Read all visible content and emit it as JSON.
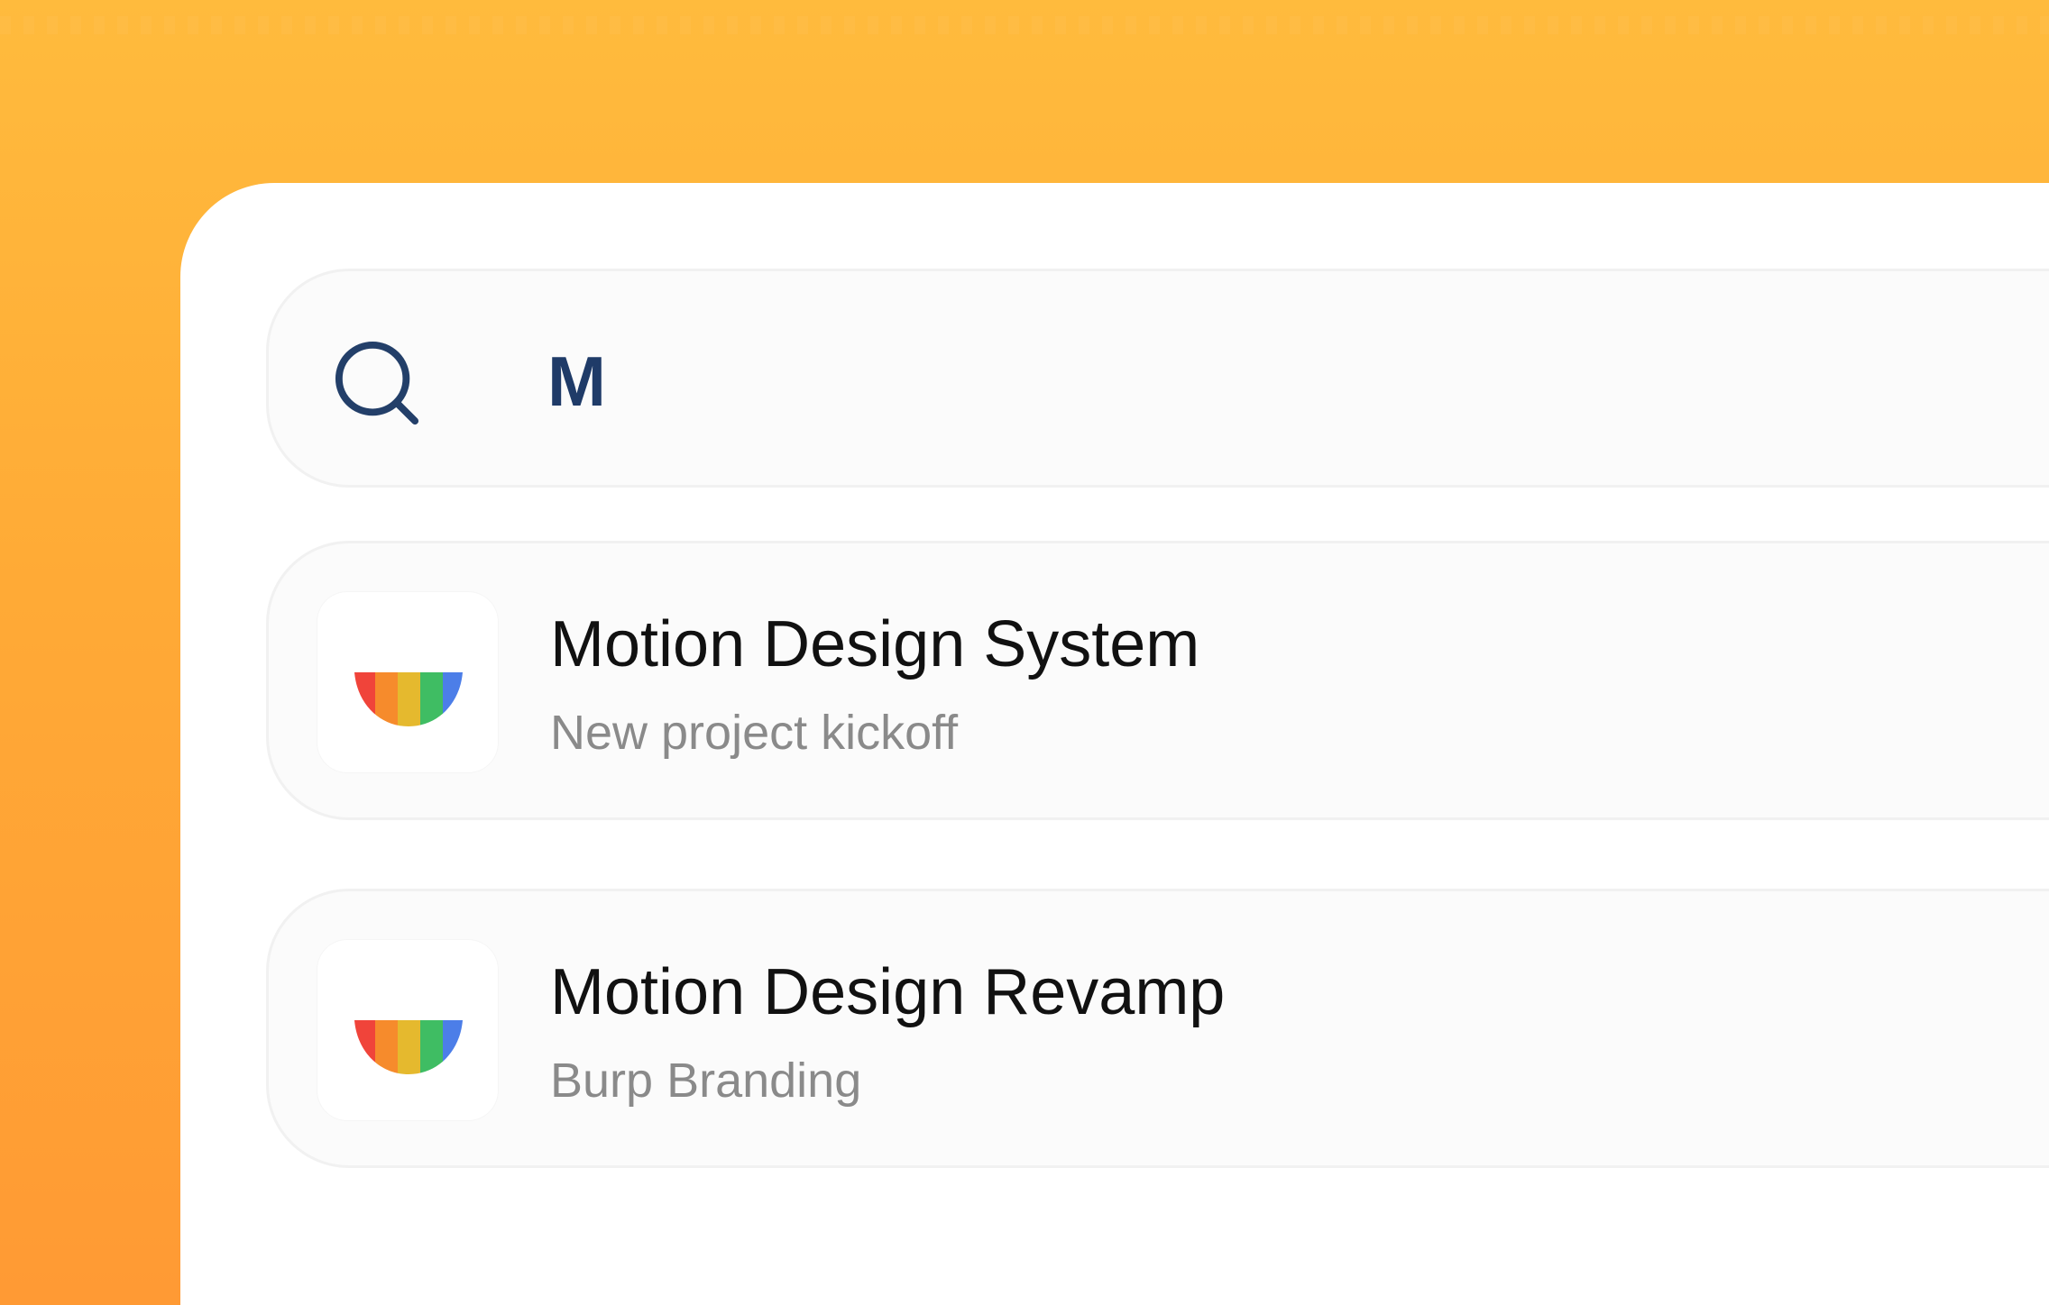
{
  "search": {
    "value": "M",
    "icon": "search-icon"
  },
  "results": [
    {
      "title": "Motion Design System",
      "subtitle": "New project kickoff",
      "icon": "rainbow-icon"
    },
    {
      "title": "Motion Design Revamp",
      "subtitle": "Burp Branding",
      "icon": "rainbow-icon"
    }
  ],
  "colors": {
    "background_top": "#ffbb3d",
    "background_bottom": "#ff9a34",
    "search_text": "#1f3b68",
    "title_text": "#111111",
    "subtitle_text": "#8a8a8a",
    "rainbow": [
      "#f0443a",
      "#f68b2c",
      "#e5b92e",
      "#3fbd63",
      "#4c7ee8"
    ]
  }
}
